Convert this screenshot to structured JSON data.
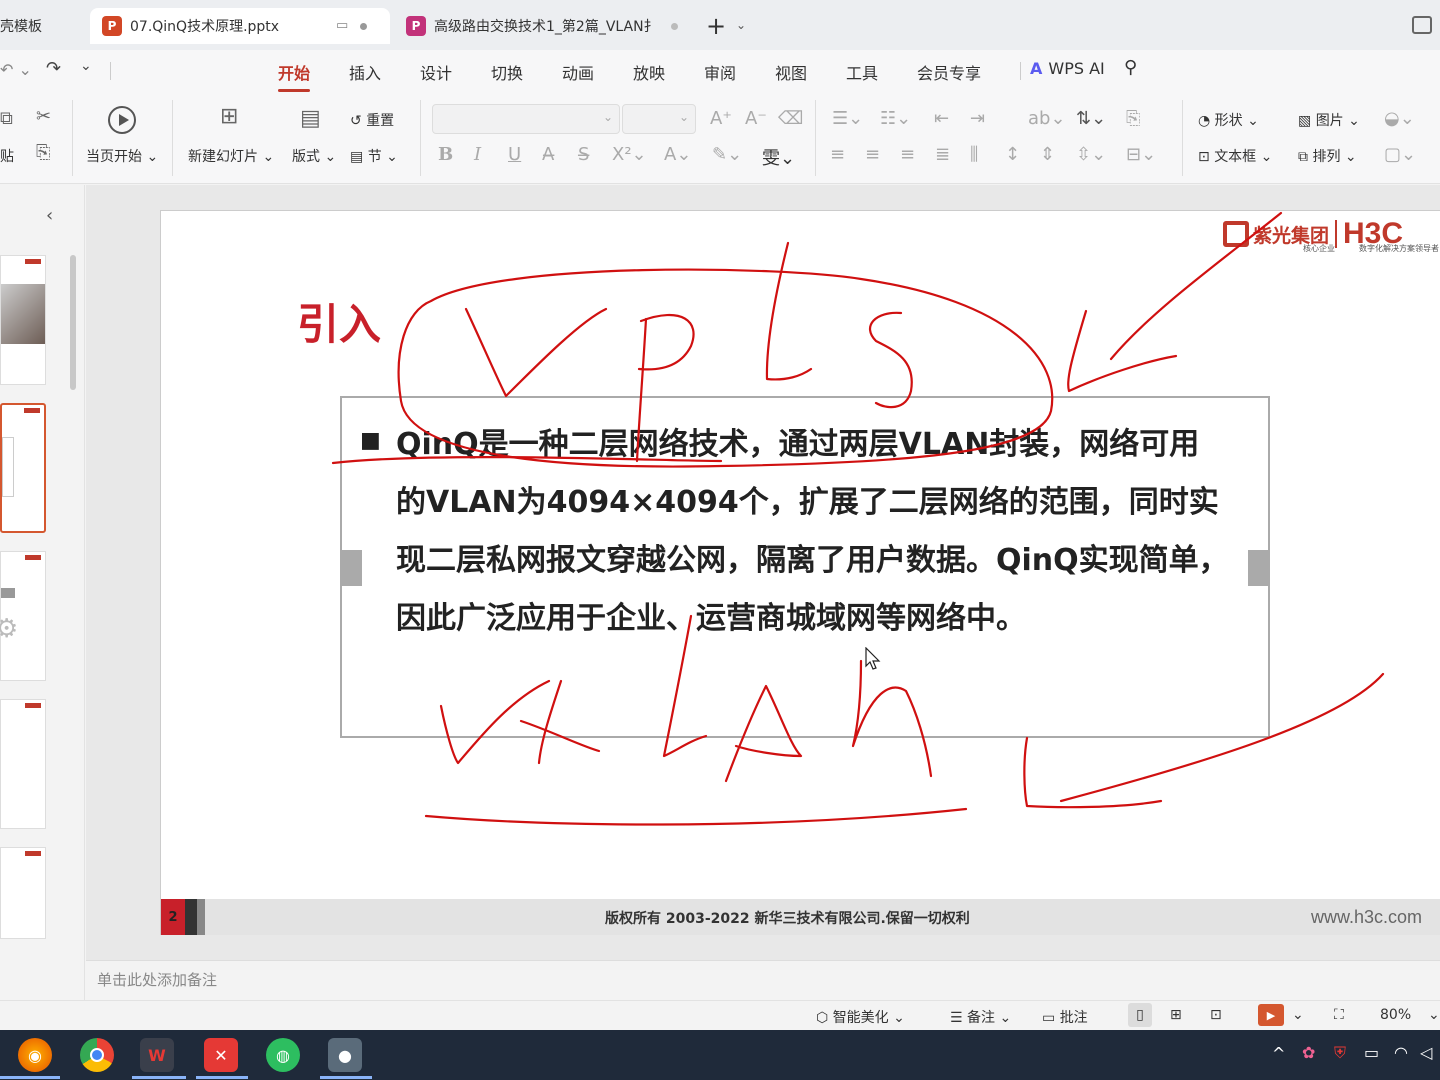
{
  "tabs": [
    {
      "label": "壳模板",
      "active": false
    },
    {
      "label": "07.QinQ技术原理.pptx",
      "active": true,
      "icon": "P"
    },
    {
      "label": "高级路由交换技术1_第2篇_VLAN扌",
      "active": false,
      "icon": "P"
    }
  ],
  "menu": [
    "开始",
    "插入",
    "设计",
    "切换",
    "动画",
    "放映",
    "审阅",
    "视图",
    "工具",
    "会员专享"
  ],
  "wps_ai": "WPS AI",
  "ribbon": {
    "paste": "贴",
    "from_current": "当页开始",
    "new_slide": "新建幻灯片",
    "layout": "版式",
    "reset": "重置",
    "section": "节",
    "shape": "形状",
    "picture": "图片",
    "textbox": "文本框",
    "arrange": "排列"
  },
  "slide": {
    "logo_cn": "紫光集团",
    "logo_en": "H3C",
    "logo_sub1": "核心企业",
    "logo_sub2": "数字化解决方案领导者",
    "title": "引入",
    "bullet": "■",
    "lines": [
      "QinQ是一种二层网络技术，通过两层VLAN封装，网络可用",
      "的VLAN为4094×4094个，扩展了二层网络的范围，同时实",
      "现二层私网报文穿越公网，隔离了用户数据。QinQ实现简单，",
      "因此广泛应用于企业、运营商城域网等网络中。"
    ],
    "footer_copyright": "版权所有 2003-2022 新华三技术有限公司.保留一切权利",
    "footer_url": "www.h3c.com",
    "page_number": "2"
  },
  "notes_placeholder": "单击此处添加备注",
  "status": {
    "beautify": "智能美化",
    "notes": "备注",
    "comment": "批注",
    "zoom": "80%"
  },
  "colors": {
    "accent": "#c0392b",
    "ink": "#d01010"
  }
}
